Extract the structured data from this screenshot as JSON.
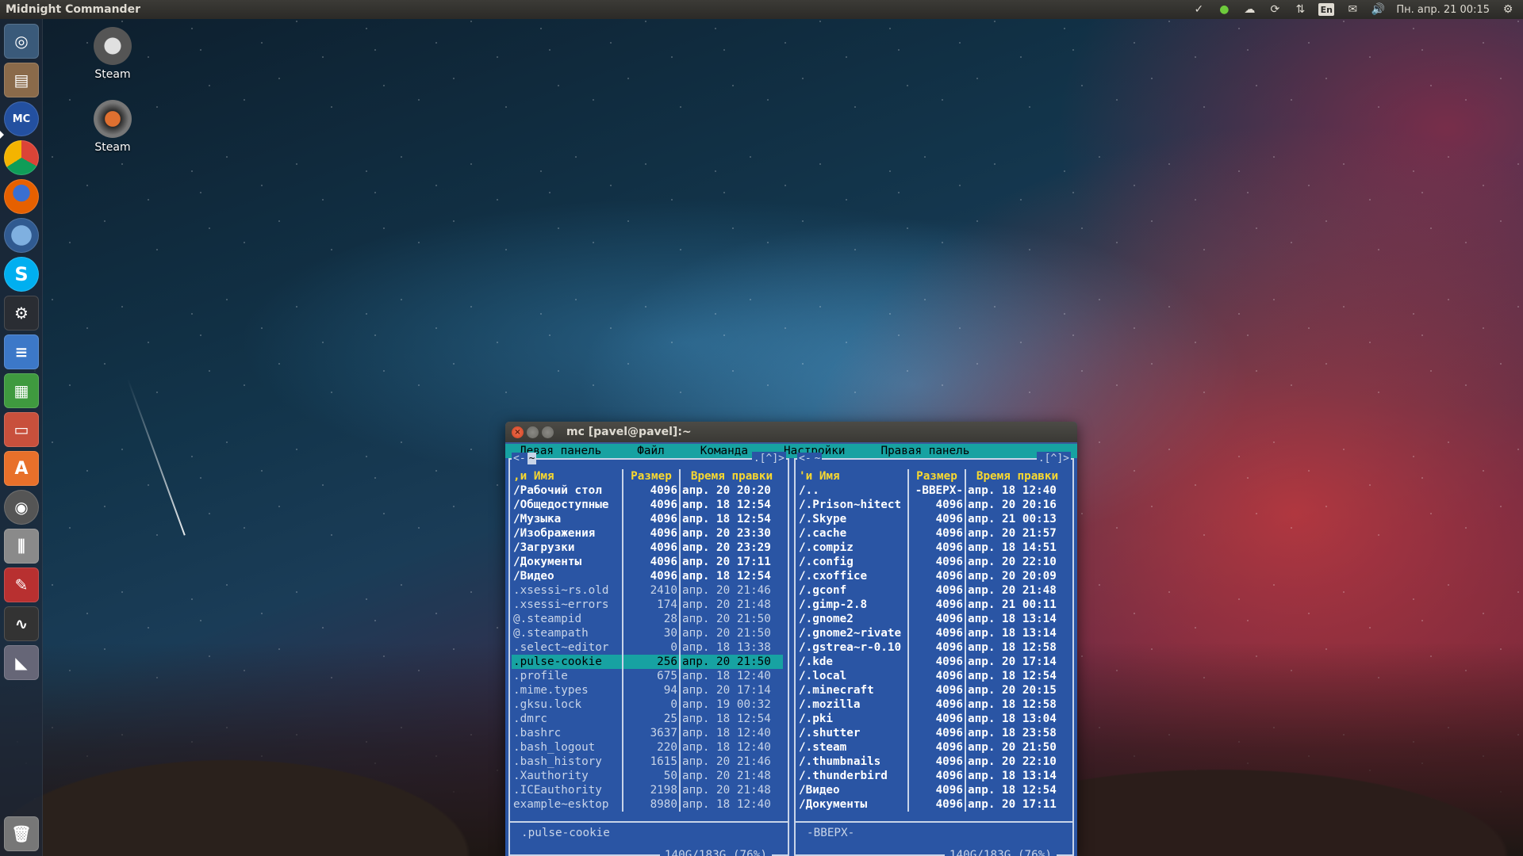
{
  "top_panel": {
    "app_title": "Midnight Commander",
    "lang_indicator": "En",
    "clock": "Пн. апр. 21 00:15",
    "indicators": [
      "steam-tray-icon",
      "shield-tray-icon",
      "cloud-tray-icon",
      "sync-tray-icon",
      "network-icon",
      "lang-icon",
      "mail-icon",
      "volume-icon",
      "gear-icon"
    ]
  },
  "launcher": {
    "items": [
      {
        "name": "dash-home",
        "glyph": "◎"
      },
      {
        "name": "files",
        "glyph": "▤"
      },
      {
        "name": "midnight-commander",
        "glyph": "MC"
      },
      {
        "name": "chrome",
        "glyph": ""
      },
      {
        "name": "firefox",
        "glyph": ""
      },
      {
        "name": "thunderbird",
        "glyph": ""
      },
      {
        "name": "skype",
        "glyph": "S"
      },
      {
        "name": "steam",
        "glyph": "⚙"
      },
      {
        "name": "libreoffice-writer",
        "glyph": "≡"
      },
      {
        "name": "libreoffice-calc",
        "glyph": "▦"
      },
      {
        "name": "libreoffice-impress",
        "glyph": "▭"
      },
      {
        "name": "software-center",
        "glyph": "A"
      },
      {
        "name": "disk",
        "glyph": "◉"
      },
      {
        "name": "settings",
        "glyph": "⫼"
      },
      {
        "name": "tools",
        "glyph": "✎"
      },
      {
        "name": "system-monitor",
        "glyph": "∿"
      },
      {
        "name": "shutter",
        "glyph": "◣"
      },
      {
        "name": "trash",
        "glyph": "🗑"
      }
    ]
  },
  "desktop": {
    "icons": [
      {
        "label": "Steam"
      },
      {
        "label": "Steam"
      }
    ]
  },
  "window": {
    "title": "mc [pavel@pavel]:~",
    "menu": [
      "Левая панель",
      "Файл",
      "Команда",
      "Настройки",
      "Правая панель"
    ],
    "left": {
      "path": "~",
      "path_left_marker": "<-",
      "controls": ".[^]>",
      "headers": [
        ",и    Имя",
        "Размер",
        "Время правки"
      ],
      "rows": [
        {
          "name": "/Рабочий стол",
          "size": "4096",
          "time": "апр. 20 20:20",
          "type": "dir"
        },
        {
          "name": "/Общедоступные",
          "size": "4096",
          "time": "апр. 18 12:54",
          "type": "dir"
        },
        {
          "name": "/Музыка",
          "size": "4096",
          "time": "апр. 18 12:54",
          "type": "dir"
        },
        {
          "name": "/Изображения",
          "size": "4096",
          "time": "апр. 20 23:30",
          "type": "dir"
        },
        {
          "name": "/Загрузки",
          "size": "4096",
          "time": "апр. 20 23:29",
          "type": "dir"
        },
        {
          "name": "/Документы",
          "size": "4096",
          "time": "апр. 20 17:11",
          "type": "dir"
        },
        {
          "name": "/Видео",
          "size": "4096",
          "time": "апр. 18 12:54",
          "type": "dir"
        },
        {
          "name": " .xsessi~rs.old",
          "size": "2410",
          "time": "апр. 20 21:46",
          "type": "file"
        },
        {
          "name": " .xsessi~errors",
          "size": "174",
          "time": "апр. 20 21:48",
          "type": "file"
        },
        {
          "name": "@.steampid",
          "size": "28",
          "time": "апр. 20 21:50",
          "type": "file"
        },
        {
          "name": "@.steampath",
          "size": "30",
          "time": "апр. 20 21:50",
          "type": "file"
        },
        {
          "name": " .select~editor",
          "size": "0",
          "time": "апр. 18 13:38",
          "type": "file"
        },
        {
          "name": " .pulse-cookie",
          "size": "256",
          "time": "апр. 20 21:50",
          "type": "sel"
        },
        {
          "name": " .profile",
          "size": "675",
          "time": "апр. 18 12:40",
          "type": "file"
        },
        {
          "name": " .mime.types",
          "size": "94",
          "time": "апр. 20 17:14",
          "type": "file"
        },
        {
          "name": " .gksu.lock",
          "size": "0",
          "time": "апр. 19 00:32",
          "type": "file"
        },
        {
          "name": " .dmrc",
          "size": "25",
          "time": "апр. 18 12:54",
          "type": "file"
        },
        {
          "name": " .bashrc",
          "size": "3637",
          "time": "апр. 18 12:40",
          "type": "file"
        },
        {
          "name": " .bash_logout",
          "size": "220",
          "time": "апр. 18 12:40",
          "type": "file"
        },
        {
          "name": " .bash_history",
          "size": "1615",
          "time": "апр. 20 21:46",
          "type": "file"
        },
        {
          "name": " .Xauthority",
          "size": "50",
          "time": "апр. 20 21:48",
          "type": "file"
        },
        {
          "name": " .ICEauthority",
          "size": "2198",
          "time": "апр. 20 21:48",
          "type": "file"
        },
        {
          "name": " example~esktop",
          "size": "8980",
          "time": "апр. 18 12:40",
          "type": "file"
        }
      ],
      "info": " .pulse-cookie",
      "free": "140G/183G (76%)"
    },
    "right": {
      "path": "~",
      "path_left_marker": "<-",
      "controls": ".[^]>",
      "headers": [
        "'и    Имя",
        "Размер",
        "Время правки"
      ],
      "rows": [
        {
          "name": "/..",
          "size": "-ВВЕРХ-",
          "time": "апр. 18 12:40",
          "type": "dir"
        },
        {
          "name": "/.Prison~hitect",
          "size": "4096",
          "time": "апр. 20 20:16",
          "type": "dir"
        },
        {
          "name": "/.Skype",
          "size": "4096",
          "time": "апр. 21 00:13",
          "type": "dir"
        },
        {
          "name": "/.cache",
          "size": "4096",
          "time": "апр. 20 21:57",
          "type": "dir"
        },
        {
          "name": "/.compiz",
          "size": "4096",
          "time": "апр. 18 14:51",
          "type": "dir"
        },
        {
          "name": "/.config",
          "size": "4096",
          "time": "апр. 20 22:10",
          "type": "dir"
        },
        {
          "name": "/.cxoffice",
          "size": "4096",
          "time": "апр. 20 20:09",
          "type": "dir"
        },
        {
          "name": "/.gconf",
          "size": "4096",
          "time": "апр. 20 21:48",
          "type": "dir"
        },
        {
          "name": "/.gimp-2.8",
          "size": "4096",
          "time": "апр. 21 00:11",
          "type": "dir"
        },
        {
          "name": "/.gnome2",
          "size": "4096",
          "time": "апр. 18 13:14",
          "type": "dir"
        },
        {
          "name": "/.gnome2~rivate",
          "size": "4096",
          "time": "апр. 18 13:14",
          "type": "dir"
        },
        {
          "name": "/.gstrea~r-0.10",
          "size": "4096",
          "time": "апр. 18 12:58",
          "type": "dir"
        },
        {
          "name": "/.kde",
          "size": "4096",
          "time": "апр. 20 17:14",
          "type": "dir"
        },
        {
          "name": "/.local",
          "size": "4096",
          "time": "апр. 18 12:54",
          "type": "dir"
        },
        {
          "name": "/.minecraft",
          "size": "4096",
          "time": "апр. 20 20:15",
          "type": "dir"
        },
        {
          "name": "/.mozilla",
          "size": "4096",
          "time": "апр. 18 12:58",
          "type": "dir"
        },
        {
          "name": "/.pki",
          "size": "4096",
          "time": "апр. 18 13:04",
          "type": "dir"
        },
        {
          "name": "/.shutter",
          "size": "4096",
          "time": "апр. 18 23:58",
          "type": "dir"
        },
        {
          "name": "/.steam",
          "size": "4096",
          "time": "апр. 20 21:50",
          "type": "dir"
        },
        {
          "name": "/.thumbnails",
          "size": "4096",
          "time": "апр. 20 22:10",
          "type": "dir"
        },
        {
          "name": "/.thunderbird",
          "size": "4096",
          "time": "апр. 18 13:14",
          "type": "dir"
        },
        {
          "name": "/Видео",
          "size": "4096",
          "time": "апр. 18 12:54",
          "type": "dir"
        },
        {
          "name": "/Документы",
          "size": "4096",
          "time": "апр. 20 17:11",
          "type": "dir"
        }
      ],
      "info": "-ВВЕРХ-",
      "free": "140G/183G (76%)"
    }
  }
}
